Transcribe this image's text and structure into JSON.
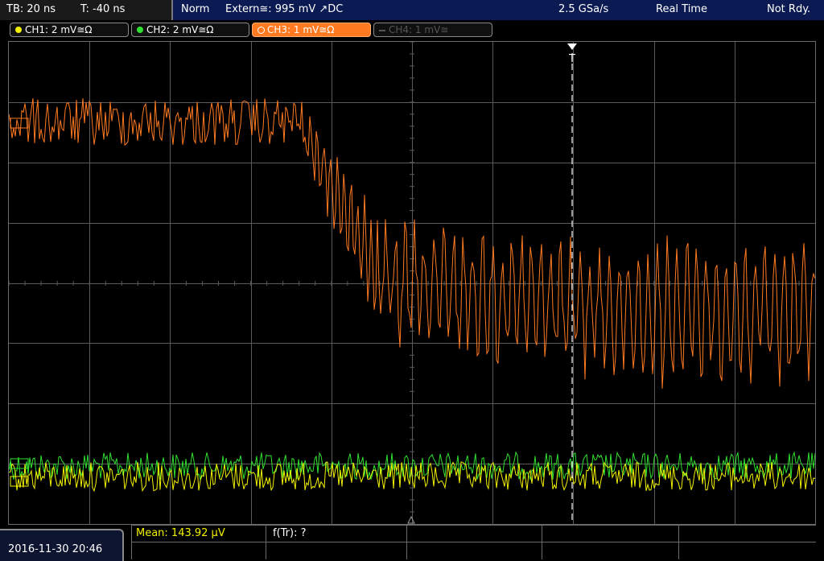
{
  "header": {
    "timebase": "TB: 20 ns",
    "trigger_pos": "T: -40 ns",
    "mode": "Norm",
    "trigger_source": "Extern≅: 995 mV ↗DC",
    "sample_rate": "2.5 GSa/s",
    "acq_mode": "Real Time",
    "status": "Not Rdy."
  },
  "channels": [
    {
      "label": "CH1: 2 mV≅Ω",
      "color": "#f2f200",
      "active": true
    },
    {
      "label": "CH2: 2 mV≅Ω",
      "color": "#30e030",
      "active": true
    },
    {
      "label": "CH3: 1 mV≅Ω",
      "color": "#ff7a20",
      "active": true
    },
    {
      "label": "CH4: 1 mV≅",
      "color": "#555555",
      "active": false
    }
  ],
  "trigger_marker": "T",
  "footer": {
    "datetime": "2016-11-30 20:46",
    "mean": "Mean: 143.92 µV",
    "f_tr": "f(Tr): ?"
  },
  "colors": {
    "ch1": "#f2f200",
    "ch2": "#30e030",
    "ch3": "#ff7a20",
    "ch4": "#555555",
    "header_bg": "#0b1a52",
    "grid": "#5a5a5a"
  }
}
